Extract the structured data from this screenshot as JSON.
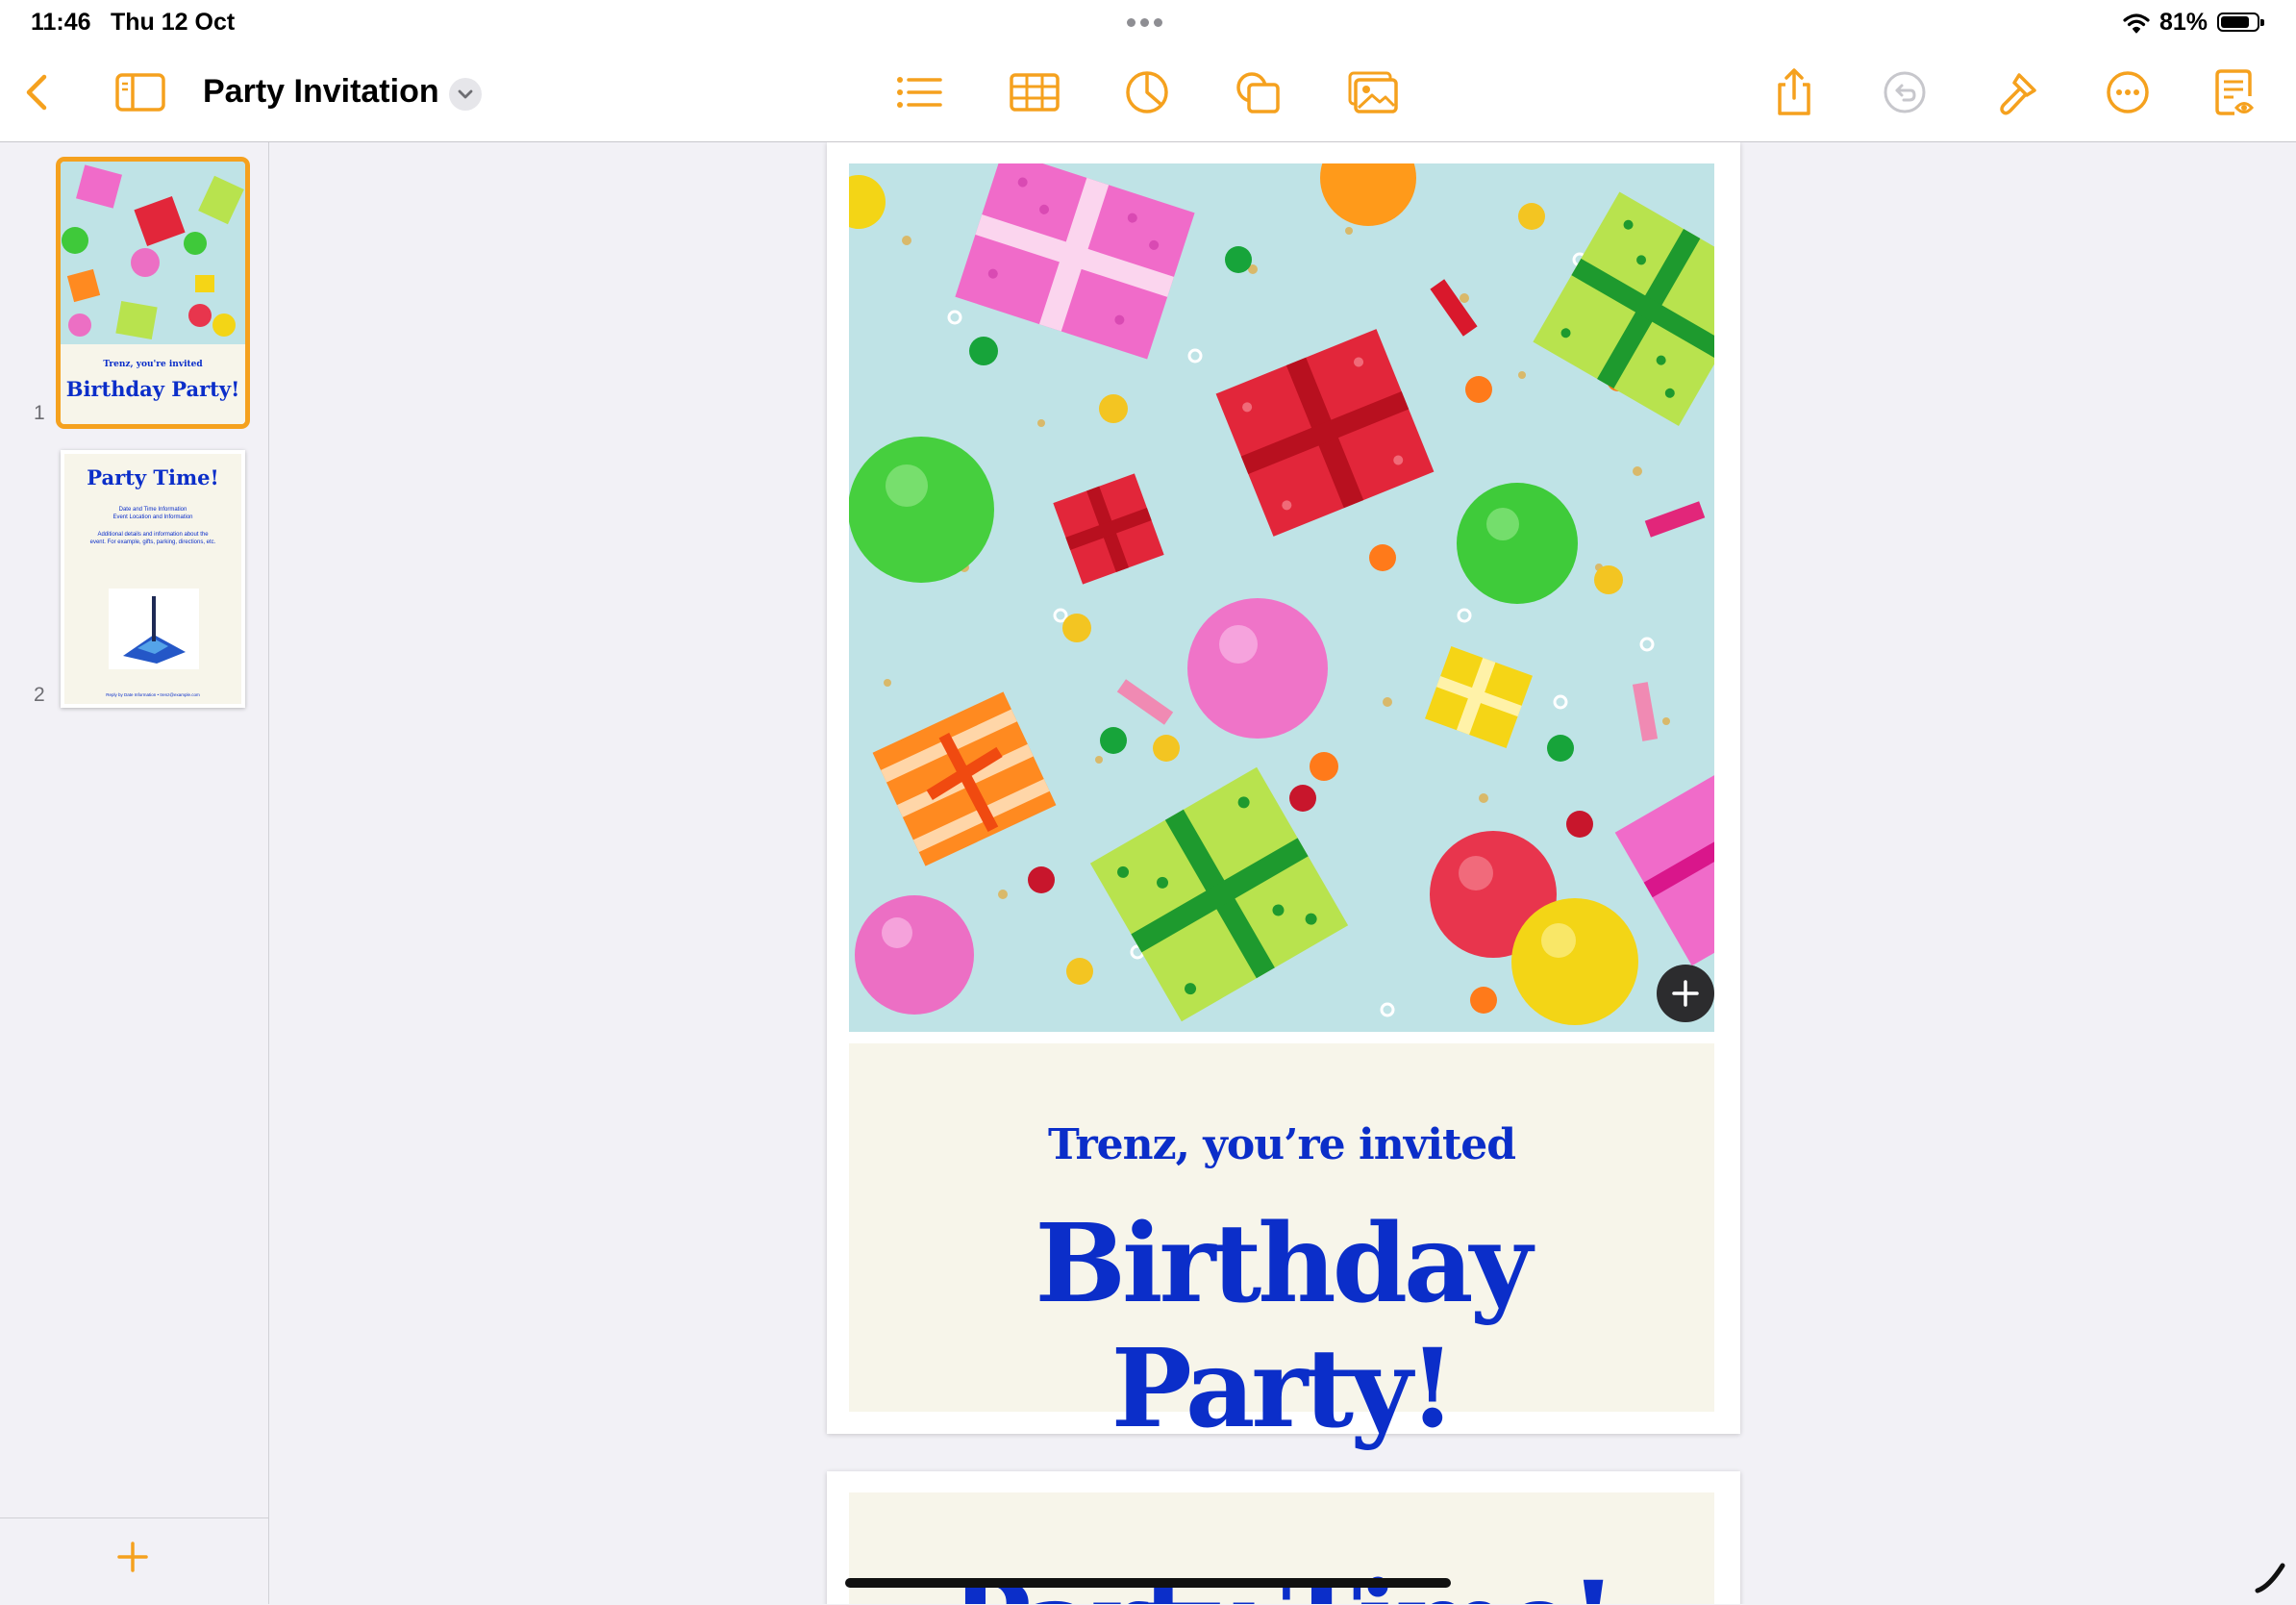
{
  "status_bar": {
    "time": "11:46",
    "date": "Thu 12 Oct",
    "battery_percent": "81%",
    "battery_level": 0.81
  },
  "toolbar": {
    "title": "Party Invitation",
    "accent_color": "#f5a11e",
    "left_icons": [
      "back-chevron-icon",
      "sidebar-toggle-icon",
      "chevron-down-icon"
    ],
    "center_icons": [
      "list-icon",
      "table-icon",
      "chart-icon",
      "shapes-icon",
      "media-icon"
    ],
    "right_icons": [
      "share-icon",
      "undo-icon",
      "paintbrush-icon",
      "more-icon",
      "document-view-icon"
    ]
  },
  "sidebar": {
    "pages": [
      {
        "number": "1",
        "subtitle": "Trenz, you're invited",
        "title": "Birthday Party!"
      },
      {
        "number": "2",
        "title": "Party Time!",
        "lines": [
          "Date and Time Information",
          "Event Location and Information",
          "Additional details and information about the event. For example, gifts, parking, directions, etc."
        ],
        "footer": "Reply by Date Information • trenz@example.com"
      }
    ]
  },
  "document": {
    "page1": {
      "subtitle": "Trenz, you’re invited",
      "title": "Birthday Party!"
    },
    "page2": {
      "title": "Party Time!"
    },
    "title_color": "#0b2ec9",
    "cream_color": "#f7f5ea"
  }
}
